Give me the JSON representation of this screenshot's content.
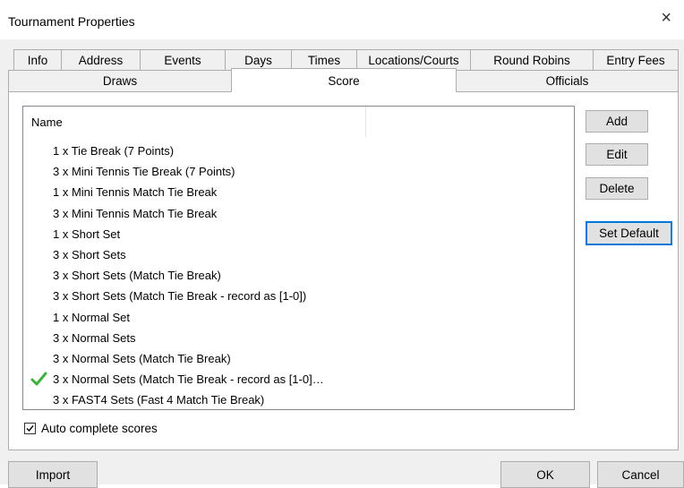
{
  "window": {
    "title": "Tournament Properties",
    "close_symbol": "×"
  },
  "tabs_row1": [
    "Info",
    "Address",
    "Events",
    "Days",
    "Times",
    "Locations/Courts",
    "Round Robins",
    "Entry Fees"
  ],
  "tabs_row2": [
    "Draws",
    "Score",
    "Officials"
  ],
  "active_tab": "Score",
  "list": {
    "column_header": "Name",
    "rows": [
      {
        "label": "1 x Tie Break (7 Points)",
        "is_default": false
      },
      {
        "label": "3 x Mini Tennis Tie Break (7 Points)",
        "is_default": false
      },
      {
        "label": "1 x Mini Tennis Match Tie Break",
        "is_default": false
      },
      {
        "label": "3 x Mini Tennis Match Tie Break",
        "is_default": false
      },
      {
        "label": "1 x Short Set",
        "is_default": false
      },
      {
        "label": "3 x Short Sets",
        "is_default": false
      },
      {
        "label": "3 x Short Sets (Match Tie Break)",
        "is_default": false
      },
      {
        "label": "3 x Short Sets (Match Tie Break - record as [1-0])",
        "is_default": false
      },
      {
        "label": "1 x Normal Set",
        "is_default": false
      },
      {
        "label": "3 x Normal Sets",
        "is_default": false
      },
      {
        "label": "3 x Normal Sets (Match Tie Break)",
        "is_default": false
      },
      {
        "label": "3 x Normal Sets (Match Tie Break - record as [1-0]…",
        "is_default": true
      },
      {
        "label": "3 x FAST4 Sets (Fast 4 Match Tie Break)",
        "is_default": false
      }
    ]
  },
  "side_buttons": {
    "add": "Add",
    "edit": "Edit",
    "delete": "Delete",
    "set_default": "Set Default"
  },
  "auto_complete": {
    "label": "Auto complete scores",
    "checked": true
  },
  "bottom_buttons": {
    "import": "Import",
    "ok": "OK",
    "cancel": "Cancel"
  },
  "colors": {
    "check_green": "#3db33d",
    "default_border": "#0078d7"
  },
  "icons": {
    "default_marker": "check-icon",
    "close": "close-icon"
  }
}
